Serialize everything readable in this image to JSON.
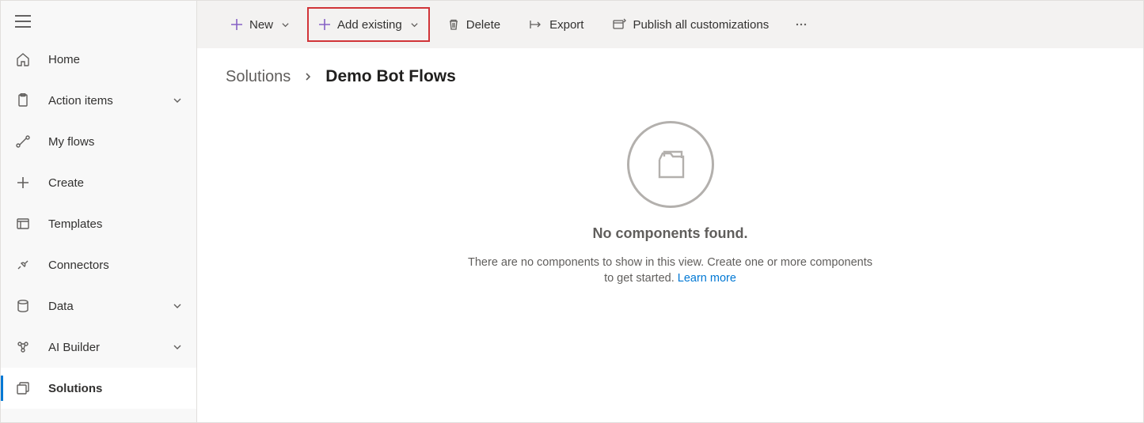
{
  "sidebar": {
    "items": [
      {
        "label": "Home"
      },
      {
        "label": "Action items"
      },
      {
        "label": "My flows"
      },
      {
        "label": "Create"
      },
      {
        "label": "Templates"
      },
      {
        "label": "Connectors"
      },
      {
        "label": "Data"
      },
      {
        "label": "AI Builder"
      },
      {
        "label": "Solutions"
      }
    ]
  },
  "commands": {
    "new": "New",
    "add_existing": "Add existing",
    "delete": "Delete",
    "export": "Export",
    "publish": "Publish all customizations"
  },
  "breadcrumb": {
    "parent": "Solutions",
    "current": "Demo Bot Flows"
  },
  "empty": {
    "title": "No components found.",
    "desc": "There are no components to show in this view. Create one or more components to get started. ",
    "learn_more": "Learn more"
  }
}
